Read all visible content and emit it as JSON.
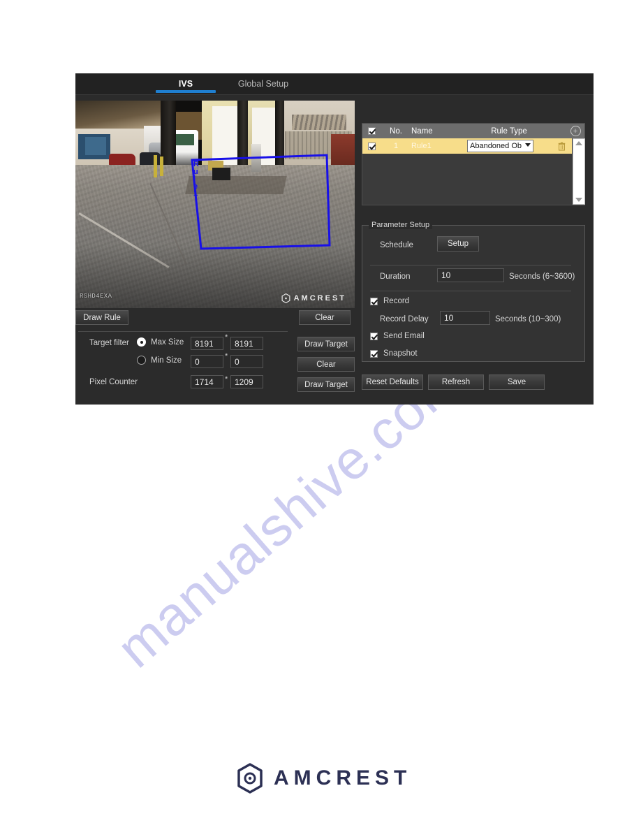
{
  "window": {
    "tabs": [
      {
        "label": "IVS",
        "active": true
      },
      {
        "label": "Global Setup",
        "active": false
      }
    ]
  },
  "video": {
    "osd_text": "RSHD4EXA",
    "watermark_brand": "AMCREST",
    "rule_label": "Rule1",
    "rule_polygon_color": "#1810e8"
  },
  "left_controls": {
    "draw_rule_button": "Draw Rule",
    "clear_button_1": "Clear",
    "target_filter_label": "Target filter",
    "max_size_label": "Max Size",
    "min_size_label": "Min Size",
    "max_size_selected": true,
    "min_size_selected": false,
    "max_width": "8191",
    "max_height": "8191",
    "min_width": "0",
    "min_height": "0",
    "multiply_symbol": "*",
    "pixel_counter_label": "Pixel Counter",
    "pixel_width": "1714",
    "pixel_height": "1209",
    "draw_target_button_1": "Draw Target",
    "clear_button_2": "Clear",
    "draw_target_button_2": "Draw Target"
  },
  "rule_table": {
    "header": {
      "select_all_checked": true,
      "no": "No.",
      "name": "Name",
      "rule_type": "Rule Type",
      "add_icon": "add-icon"
    },
    "rows": [
      {
        "checked": true,
        "no": "1",
        "name": "Rule1",
        "rule_type": "Abandoned Ob",
        "delete_icon": "trash-icon"
      }
    ]
  },
  "parameter_setup": {
    "legend": "Parameter Setup",
    "schedule_label": "Schedule",
    "schedule_button": "Setup",
    "duration_label": "Duration",
    "duration_value": "10",
    "duration_unit": "Seconds (6~3600)",
    "record_label": "Record",
    "record_checked": true,
    "record_delay_label": "Record Delay",
    "record_delay_value": "10",
    "record_delay_unit": "Seconds (10~300)",
    "send_email_label": "Send Email",
    "send_email_checked": true,
    "snapshot_label": "Snapshot",
    "snapshot_checked": true
  },
  "actions": {
    "reset_defaults": "Reset Defaults",
    "refresh": "Refresh",
    "save": "Save"
  },
  "page": {
    "watermark": "manualshive.com",
    "footer_brand": "AMCREST"
  },
  "colors": {
    "accent_blue": "#1f7fd0",
    "row_highlight": "#f7dd8a",
    "panel_bg": "#2b2b2b",
    "brand_navy": "#2c3054"
  }
}
